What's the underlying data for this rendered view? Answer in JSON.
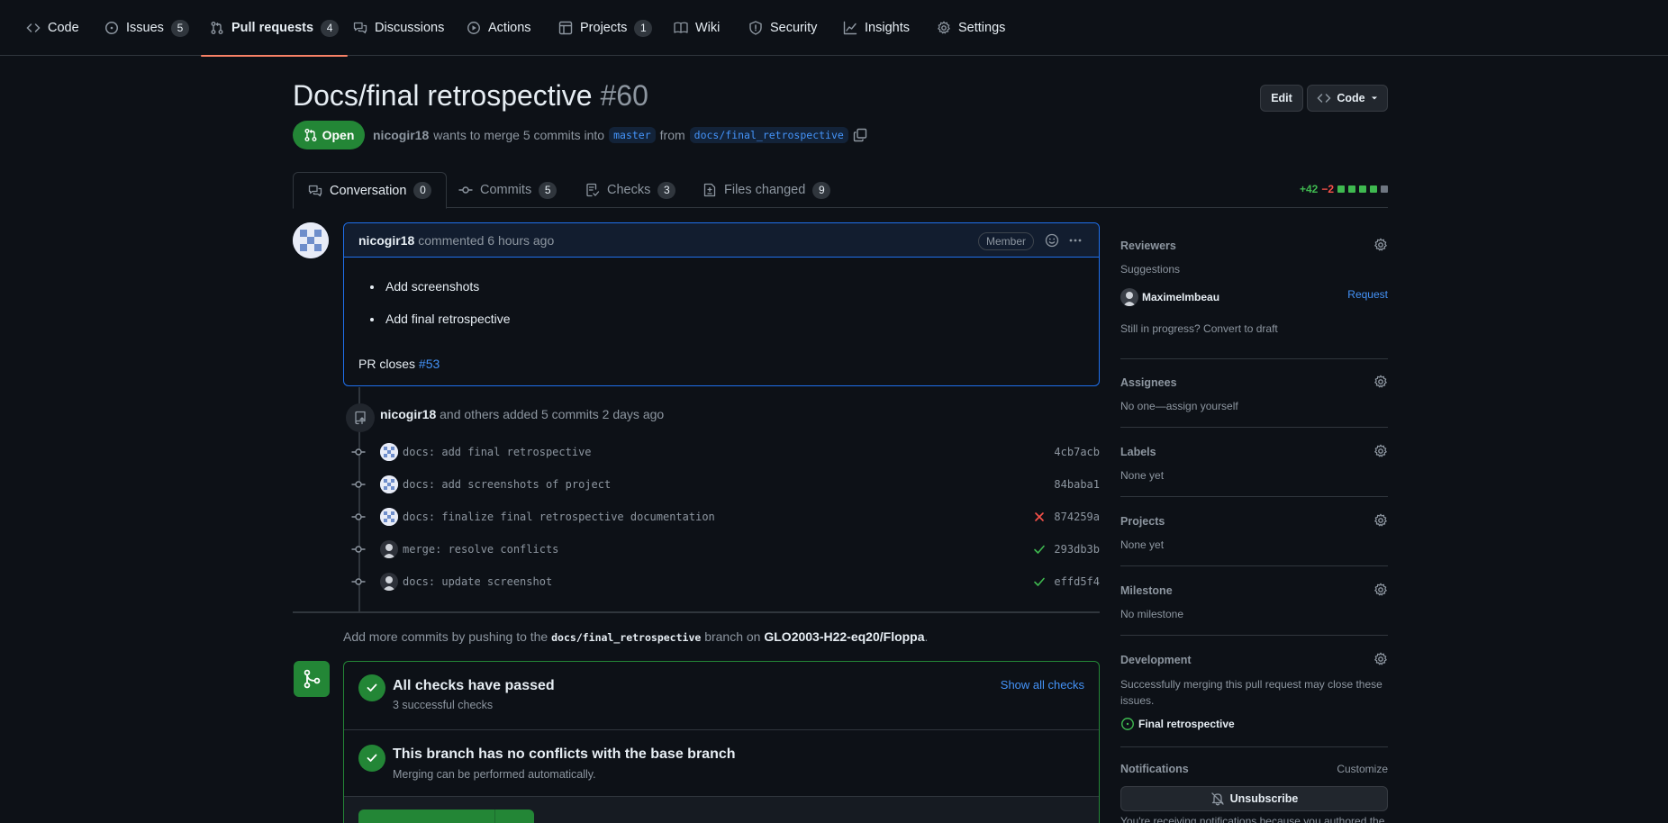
{
  "nav": {
    "items": [
      {
        "label": "Code",
        "icon": "code-icon"
      },
      {
        "label": "Issues",
        "count": "5",
        "icon": "issue-opened-icon"
      },
      {
        "label": "Pull requests",
        "count": "4",
        "icon": "git-pull-request-icon"
      },
      {
        "label": "Discussions",
        "icon": "comment-discussion-icon"
      },
      {
        "label": "Actions",
        "icon": "play-icon"
      },
      {
        "label": "Projects",
        "count": "1",
        "icon": "table-icon"
      },
      {
        "label": "Wiki",
        "icon": "book-icon"
      },
      {
        "label": "Security",
        "icon": "shield-icon"
      },
      {
        "label": "Insights",
        "icon": "graph-icon"
      },
      {
        "label": "Settings",
        "icon": "gear-icon"
      }
    ],
    "active_index": 2
  },
  "pr": {
    "title": "Docs/final retrospective",
    "number": "#60",
    "edit_label": "Edit",
    "code_label": "Code",
    "state": "Open",
    "author": "nicogir18",
    "merge_text_1": "wants to merge 5 commits into",
    "base_branch": "master",
    "merge_text_2": "from",
    "head_branch": "docs/final_retrospective"
  },
  "tabs": [
    {
      "label": "Conversation",
      "count": "0",
      "icon": "comment-discussion-icon"
    },
    {
      "label": "Commits",
      "count": "5",
      "icon": "git-commit-icon"
    },
    {
      "label": "Checks",
      "count": "3",
      "icon": "checklist-icon"
    },
    {
      "label": "Files changed",
      "count": "9",
      "icon": "file-diff-icon"
    }
  ],
  "diffstat": {
    "additions": "+42",
    "deletions": "−2"
  },
  "comment": {
    "author": "nicogir18",
    "action": "commented 6 hours ago",
    "badge": "Member",
    "bullets": [
      "Add screenshots",
      "Add final retrospective"
    ],
    "closes_text": "PR closes",
    "closes_ref": "#53"
  },
  "commits_summary": {
    "author": "nicogir18",
    "text": "and others added 5 commits 2 days ago"
  },
  "commits": [
    {
      "message": "docs: add final retrospective",
      "sha": "4cb7acb",
      "status": "none",
      "avatar": "identicon"
    },
    {
      "message": "docs: add screenshots of project",
      "sha": "84baba1",
      "status": "none",
      "avatar": "identicon"
    },
    {
      "message": "docs: finalize final retrospective documentation",
      "sha": "874259a",
      "status": "failure",
      "avatar": "identicon"
    },
    {
      "message": "merge: resolve conflicts",
      "sha": "293db3b",
      "status": "success",
      "avatar": "photo"
    },
    {
      "message": "docs: update screenshot",
      "sha": "effd5f4",
      "status": "success",
      "avatar": "photo"
    }
  ],
  "push_hint": {
    "prefix": "Add more commits by pushing to the",
    "branch": "docs/final_retrospective",
    "middle": "branch on",
    "repo": "GLO2003-H22-eq20/Floppa",
    "suffix": "."
  },
  "merge_box": {
    "checks_title": "All checks have passed",
    "checks_sub": "3 successful checks",
    "show_all": "Show all checks",
    "conflicts_title": "This branch has no conflicts with the base branch",
    "conflicts_sub": "Merging can be performed automatically."
  },
  "sidebar": {
    "reviewers": {
      "title": "Reviewers",
      "suggestions": "Suggestions",
      "suggested": "MaximeImbeau",
      "request": "Request",
      "draft_hint": "Still in progress? Convert to draft"
    },
    "assignees": {
      "title": "Assignees",
      "value": "No one—assign yourself"
    },
    "labels": {
      "title": "Labels",
      "value": "None yet"
    },
    "projects": {
      "title": "Projects",
      "value": "None yet"
    },
    "milestone": {
      "title": "Milestone",
      "value": "No milestone"
    },
    "development": {
      "title": "Development",
      "text": "Successfully merging this pull request may close these issues.",
      "issue": "Final retrospective"
    },
    "notifications": {
      "title": "Notifications",
      "customize": "Customize",
      "button": "Unsubscribe",
      "note": "You're receiving notifications because you authored the"
    }
  },
  "colors": {
    "accent_green": "#238636",
    "link_blue": "#4493f8",
    "active_tab_underline": "#f78166",
    "danger": "#f85149",
    "success": "#3fb950"
  }
}
